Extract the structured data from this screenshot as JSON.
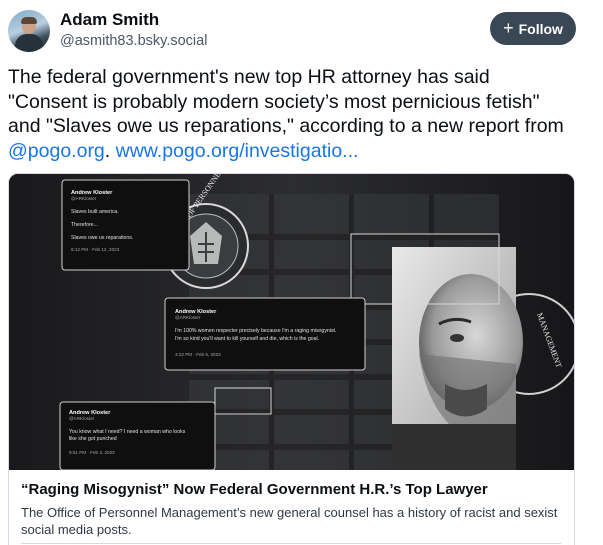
{
  "author": {
    "name": "Adam Smith",
    "handle": "@asmith83.bsky.social"
  },
  "follow_button": {
    "label": "Follow",
    "icon": "plus-icon"
  },
  "post": {
    "text_line1": "The federal government's new top HR attorney has said",
    "text_line2": "\"Consent is probably modern society’s most pernicious fetish\"",
    "text_line3": "and \"Slaves owe us reparations,\" according to a new report from",
    "mention": "@pogo.org",
    "separator": ". ",
    "link": "www.pogo.org/investigatio..."
  },
  "embed": {
    "title": "“Raging Misogynist” Now Federal Government H.R.’s Top Lawyer",
    "description": "The Office of Personnel Management’s new general counsel has a history of racist and sexist social media posts.",
    "image": {
      "seal_text_left": "OFFICE OF PERSONNEL",
      "seal_text_right": "MANAGEMENT",
      "tweets": [
        {
          "name": "Andrew Kloster",
          "handle": "@ARKloster",
          "lines": [
            "Slaves built america.",
            "Therefore...",
            "Slaves owe us reparations."
          ],
          "time": "6:12 PM · Feb 12, 2023"
        },
        {
          "name": "Andrew Kloster",
          "handle": "@ARKloster",
          "lines": [
            "I'm 100% women respecter precisely because I'm a raging misogynist.",
            "I'm so kind you'll want to kill yourself and die, which is the goal."
          ],
          "time": "3:22 PM · Feb 5, 2023"
        },
        {
          "name": "Andrew Kloster",
          "handle": "@ARKloster",
          "lines": [
            "You know what I need? I need a woman who looks",
            "like she got punched"
          ],
          "time": "9:51 PM · Feb 3, 2023"
        }
      ]
    }
  }
}
